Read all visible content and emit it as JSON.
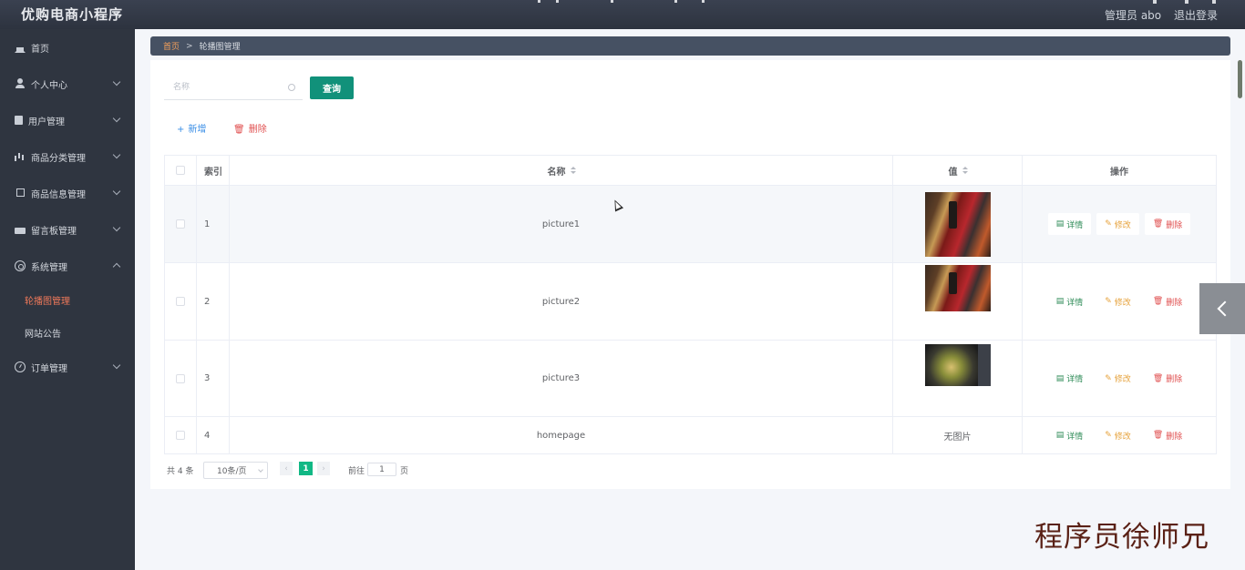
{
  "header": {
    "app_title": "优购电商小程序",
    "user_label": "管理员 abo",
    "logout_label": "退出登录"
  },
  "sidebar": {
    "items": [
      {
        "label": "首页",
        "icon": "home-icon"
      },
      {
        "label": "个人中心",
        "icon": "user-icon"
      },
      {
        "label": "用户管理",
        "icon": "clipboard-icon"
      },
      {
        "label": "商品分类管理",
        "icon": "bar-chart-icon"
      },
      {
        "label": "商品信息管理",
        "icon": "crop-icon"
      },
      {
        "label": "留言板管理",
        "icon": "ticket-icon"
      },
      {
        "label": "系统管理",
        "icon": "settings-circle-icon"
      },
      {
        "label": "订单管理",
        "icon": "clock-icon"
      }
    ],
    "sub_items": [
      {
        "label": "轮播图管理",
        "active": true
      },
      {
        "label": "网站公告",
        "active": false
      }
    ]
  },
  "breadcrumb": {
    "home": "首页",
    "separator": ">",
    "current": "轮播图管理"
  },
  "search": {
    "placeholder": "名称",
    "value": "",
    "query_label": "查询"
  },
  "actions": {
    "add_label": "新增",
    "delete_label": "删除"
  },
  "table": {
    "columns": [
      "索引",
      "名称",
      "值",
      "操作"
    ],
    "rows": [
      {
        "index": "1",
        "name": "picture1",
        "value": "",
        "image": "picture1-thumbnail"
      },
      {
        "index": "2",
        "name": "picture2",
        "value": "",
        "image": "picture2-thumbnail"
      },
      {
        "index": "3",
        "name": "picture3",
        "value": "",
        "image": "picture3-thumbnail"
      },
      {
        "index": "4",
        "name": "homepage",
        "value": "无图片",
        "image": ""
      }
    ],
    "op_labels": {
      "detail": "详情",
      "edit": "修改",
      "delete": "删除"
    }
  },
  "pagination": {
    "total_label": "共 4 条",
    "page_size": "10条/页",
    "current_page": "1",
    "goto_label": "前往",
    "goto_value": "1",
    "page_suffix": "页"
  },
  "watermark": "程序员徐师兄",
  "colors": {
    "primary": "#11917a",
    "sidebar_bg": "#2f3540",
    "active_menu": "#f0795a",
    "detail": "#2e8b57",
    "edit": "#e6a23c",
    "delete": "#e04f4f"
  }
}
